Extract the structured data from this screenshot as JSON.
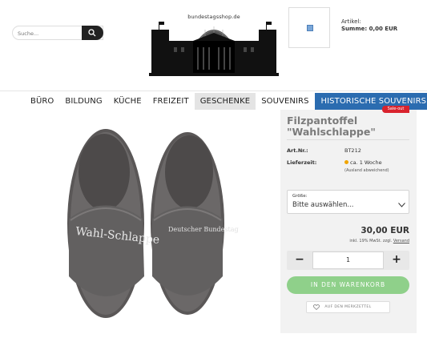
{
  "header": {
    "search_placeholder": "Suche...",
    "logo_text": "bundestagsshop.de",
    "cart_label": "Artikel:",
    "cart_sum": "Summe: 0,00 EUR"
  },
  "nav": {
    "items": [
      {
        "label": "BÜRO"
      },
      {
        "label": "BILDUNG"
      },
      {
        "label": "KÜCHE"
      },
      {
        "label": "FREIZEIT"
      },
      {
        "label": "GESCHENKE"
      },
      {
        "label": "SOUVENIRS"
      },
      {
        "label": "HISTORISCHE SOUVENIRS"
      }
    ]
  },
  "product": {
    "badge": "Sale-out",
    "title_line1": "Filzpantoffel",
    "title_line2": "\"Wahlschlappe\"",
    "sku_label": "Art.Nr.:",
    "sku_value": "BT212",
    "delivery_label": "Lieferzeit:",
    "delivery_value": "ca. 1 Woche",
    "delivery_note": "(Ausland abweichend)",
    "size_label": "Größe:",
    "size_value": "Bitte auswählen...",
    "price": "30,00 EUR",
    "tax_text": "inkl. 19% MwSt. zzgl.",
    "shipping_link": "Versand",
    "quantity": "1",
    "add_to_cart": "IN DEN WARENKORB",
    "wishlist": "AUF DEN MERKZETTEL",
    "slipper_left_text": "Wahl-Schlappe",
    "slipper_right_text": "Deutscher Bundestag"
  },
  "colors": {
    "nav_highlight": "#2b6cb0",
    "cart_button": "#8fd08a",
    "badge": "#d9232d",
    "delivery_dot": "#f0a500"
  }
}
